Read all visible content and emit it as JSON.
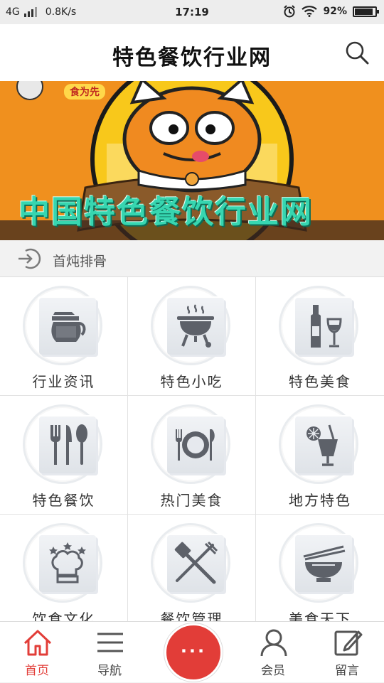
{
  "status_bar": {
    "network": "4G",
    "speed": "0.8K/s",
    "time": "17:19",
    "battery": "92%",
    "battery_level": 0.92
  },
  "header": {
    "title": "特色餐饮行业网"
  },
  "banner": {
    "slogan": "中国特色餐饮行业网",
    "logo_text": "食为先"
  },
  "ticker": {
    "text": "首炖排骨"
  },
  "categories": [
    {
      "label": "行业资讯",
      "icon": "coffee-pot-icon"
    },
    {
      "label": "特色小吃",
      "icon": "bbq-grill-icon"
    },
    {
      "label": "特色美食",
      "icon": "wine-bottle-glass-icon"
    },
    {
      "label": "特色餐饮",
      "icon": "fork-knife-spoon-icon"
    },
    {
      "label": "热门美食",
      "icon": "plate-cutlery-icon"
    },
    {
      "label": "地方特色",
      "icon": "cocktail-icon"
    },
    {
      "label": "饮食文化",
      "icon": "chef-hat-icon"
    },
    {
      "label": "餐饮管理",
      "icon": "spatula-fork-icon"
    },
    {
      "label": "美食天下",
      "icon": "bowl-chopsticks-icon"
    }
  ],
  "bottom_nav": {
    "home": "首页",
    "navigate": "导航",
    "more": "···",
    "member": "会员",
    "message": "留言"
  },
  "colors": {
    "accent": "#e23d38",
    "banner_bg": "#f0901e",
    "icon_gray": "#5d6169"
  }
}
